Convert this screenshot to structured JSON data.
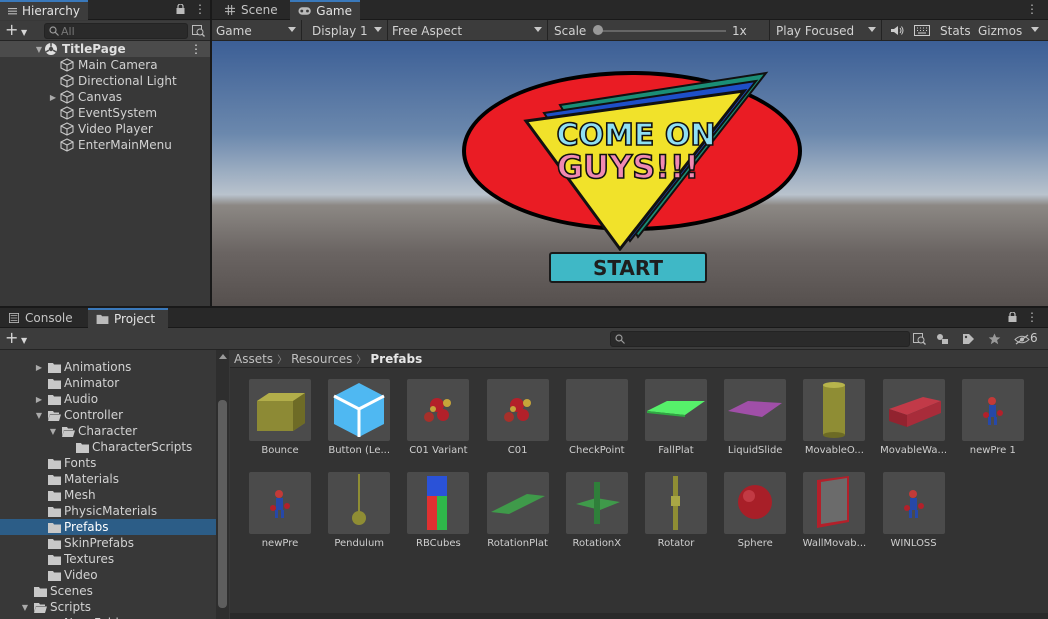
{
  "hierarchy": {
    "tab_label": "Hierarchy",
    "search_placeholder": "All",
    "scene_name": "TitlePage",
    "objects": [
      "Main Camera",
      "Directional Light",
      "Canvas",
      "EventSystem",
      "Video Player",
      "EnterMainMenu"
    ]
  },
  "scene_tab": {
    "label": "Scene"
  },
  "game_tab": {
    "label": "Game",
    "toolbar": {
      "mode": "Game",
      "display": "Display 1",
      "aspect": "Free Aspect",
      "scale_label": "Scale",
      "scale_value": "1x",
      "play_mode": "Play Focused",
      "stats": "Stats",
      "gizmos": "Gizmos"
    },
    "logo": {
      "line1": "COME ON",
      "line2": "GUYS!!!"
    },
    "start_button": "START"
  },
  "bottom": {
    "tabs": {
      "console": "Console",
      "project": "Project"
    },
    "hidden_count": "6",
    "tree": [
      {
        "label": "Animations",
        "indent": 1,
        "fold": "right"
      },
      {
        "label": "Animator",
        "indent": 1,
        "fold": ""
      },
      {
        "label": "Audio",
        "indent": 1,
        "fold": "right"
      },
      {
        "label": "Controller",
        "indent": 1,
        "fold": "down"
      },
      {
        "label": "Character",
        "indent": 2,
        "fold": "down"
      },
      {
        "label": "CharacterScripts",
        "indent": 3,
        "fold": ""
      },
      {
        "label": "Fonts",
        "indent": 1,
        "fold": ""
      },
      {
        "label": "Materials",
        "indent": 1,
        "fold": ""
      },
      {
        "label": "Mesh",
        "indent": 1,
        "fold": ""
      },
      {
        "label": "PhysicMaterials",
        "indent": 1,
        "fold": ""
      },
      {
        "label": "Prefabs",
        "indent": 1,
        "fold": "",
        "selected": true
      },
      {
        "label": "SkinPrefabs",
        "indent": 1,
        "fold": ""
      },
      {
        "label": "Textures",
        "indent": 1,
        "fold": ""
      },
      {
        "label": "Video",
        "indent": 1,
        "fold": ""
      },
      {
        "label": "Scenes",
        "indent": 0,
        "fold": ""
      },
      {
        "label": "Scripts",
        "indent": 0,
        "fold": "down"
      },
      {
        "label": "New Folder",
        "indent": 1,
        "fold": "right"
      }
    ],
    "breadcrumb": [
      "Assets",
      "Resources",
      "Prefabs"
    ],
    "assets": [
      {
        "label": "Bounce",
        "icon": "olive-cube-icon"
      },
      {
        "label": "Button (Le...",
        "icon": "blue-cube-icon"
      },
      {
        "label": "C01 Variant",
        "icon": "character-icon"
      },
      {
        "label": "C01",
        "icon": "character-icon"
      },
      {
        "label": "CheckPoint",
        "icon": "empty-icon"
      },
      {
        "label": "FallPlat",
        "icon": "green-plate-icon"
      },
      {
        "label": "LiquidSlide",
        "icon": "purple-plate-icon"
      },
      {
        "label": "MovableO...",
        "icon": "cylinder-icon"
      },
      {
        "label": "MovableWa...",
        "icon": "red-bar-icon"
      },
      {
        "label": "newPre 1",
        "icon": "figure-icon"
      },
      {
        "label": "newPre",
        "icon": "figure-icon"
      },
      {
        "label": "Pendulum",
        "icon": "pendulum-icon"
      },
      {
        "label": "RBCubes",
        "icon": "rgb-cubes-icon"
      },
      {
        "label": "RotationPlat",
        "icon": "green-plank-icon"
      },
      {
        "label": "RotationX",
        "icon": "green-cross-icon"
      },
      {
        "label": "Rotator",
        "icon": "rotator-icon"
      },
      {
        "label": "Sphere",
        "icon": "sphere-icon"
      },
      {
        "label": "WallMovab...",
        "icon": "wall-icon"
      },
      {
        "label": "WINLOSS",
        "icon": "figure-icon"
      }
    ]
  }
}
